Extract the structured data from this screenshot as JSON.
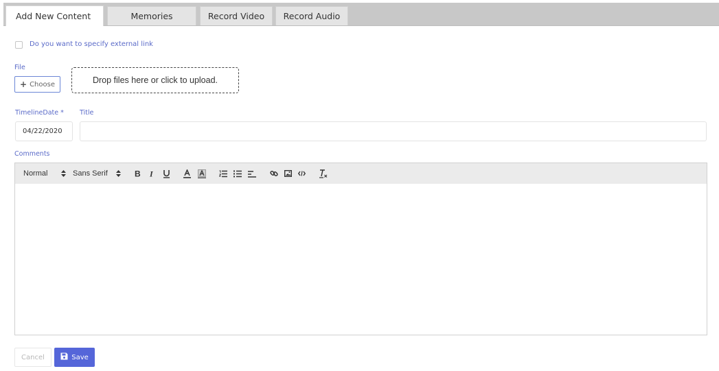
{
  "tabs": [
    {
      "label": "Add New Content",
      "active": true
    },
    {
      "label": "Memories",
      "active": false
    },
    {
      "label": "Record Video",
      "active": false
    },
    {
      "label": "Record Audio",
      "active": false
    }
  ],
  "form": {
    "external_link_label": "Do you want to specify external link",
    "external_link_checked": false,
    "file_label": "File",
    "choose_label": "Choose",
    "dropzone_text": "Drop files here or click to upload.",
    "timeline_date_label": "TimelineDate *",
    "timeline_date_value": "04/22/2020",
    "title_label": "Title",
    "title_value": "",
    "comments_label": "Comments"
  },
  "editor_toolbar": {
    "header_select": "Normal",
    "font_select": "Sans Serif",
    "buttons": [
      "bold",
      "italic",
      "underline",
      "text-color",
      "background-color",
      "ordered-list",
      "bullet-list",
      "align",
      "link",
      "image",
      "code",
      "clear-format"
    ]
  },
  "actions": {
    "cancel_label": "Cancel",
    "save_label": "Save"
  },
  "colors": {
    "accent": "#5a6ac8",
    "save_button": "#5566d9",
    "tab_bar": "#c8c8c8"
  }
}
